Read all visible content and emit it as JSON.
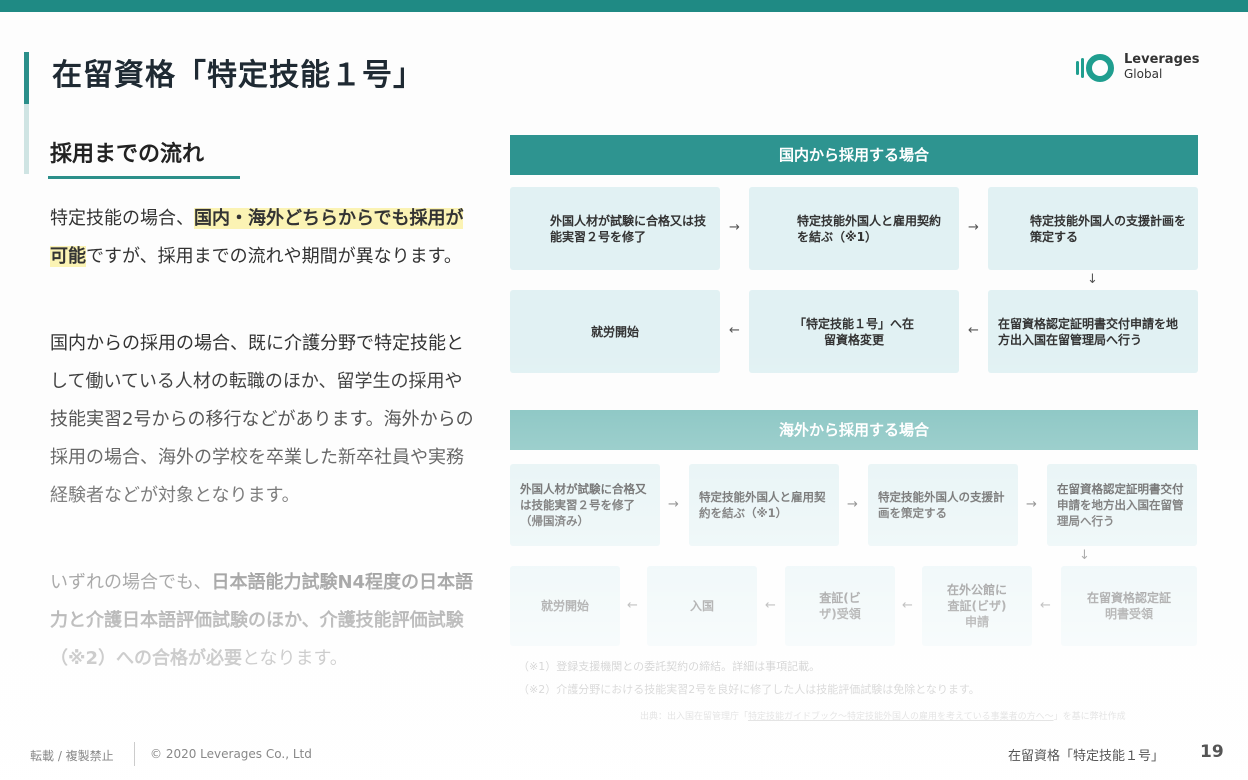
{
  "title": "在留資格「特定技能１号」",
  "logo": {
    "line1": "Leverages",
    "line2": "Global"
  },
  "section_heading": "採用までの流れ",
  "paragraph1": {
    "pre": "特定技能の場合、",
    "hl1": "国内・海外どちらからでも",
    "hl2": "採用が可能",
    "post": "ですが、採用までの流れや期間が異なります。"
  },
  "paragraph2": "国内からの採用の場合、既に介護分野で特定技能として働いている人材の転職のほか、留学生の採用や技能実習2号からの移行などがあります。海外からの採用の場合、海外の学校を卒業した新卒社員や実務経験者などが対象となります。",
  "paragraph3": {
    "pre": "いずれの場合でも、",
    "bold": "日本語能力試験N4程度の日本語力と介護日本語評価試験のほか、介護技能評価試験（※2）への合格が必要",
    "post": "となります。"
  },
  "domestic": {
    "header": "国内から採用する場合",
    "steps": [
      "外国人材が試験に合格又は技能実習２号を修了",
      "特定技能外国人と雇用契約を結ぶ（※1）",
      "特定技能外国人の支援計画を策定する",
      "在留資格認定証明書交付申請を地方出入国在留管理局へ行う",
      "「特定技能１号」へ在留資格変更",
      "就労開始"
    ]
  },
  "overseas": {
    "header": "海外から採用する場合",
    "steps": [
      "外国人材が試験に合格又は技能実習２号を修了（帰国済み）",
      "特定技能外国人と雇用契約を結ぶ（※1）",
      "特定技能外国人の支援計画を策定する",
      "在留資格認定証明書交付申請を地方出入国在留管理局へ行う",
      "在留資格認定証明書受領",
      "在外公館に査証(ビザ)申請",
      "査証(ビザ)受領",
      "入国",
      "就労開始"
    ]
  },
  "notes": {
    "note1": "（※1）登録支援機関との委託契約の締結。詳細は事項記載。",
    "note2": "（※2）介護分野における技能実習2号を良好に修了した人は技能評価試験は免除となります。"
  },
  "source": {
    "pre": "出典：出入国在留管理庁「",
    "link": "特定技能ガイドブック～特定技能外国人の雇用を考えている事業者の方へ～",
    "post": "」を基に弊社作成"
  },
  "footer": {
    "left": "転載 / 複製禁止",
    "copyright": "© 2020 Leverages Co., Ltd",
    "right": "在留資格「特定技能１号」",
    "page": "19"
  },
  "colors": {
    "accent": "#1f8a84",
    "header_domestic": "#2e9490",
    "header_overseas": "#7cbfbc",
    "box": "#e1f1f3",
    "highlight": "#fbf3b4"
  },
  "arrows": {
    "right": "→",
    "left": "←",
    "down": "↓"
  }
}
